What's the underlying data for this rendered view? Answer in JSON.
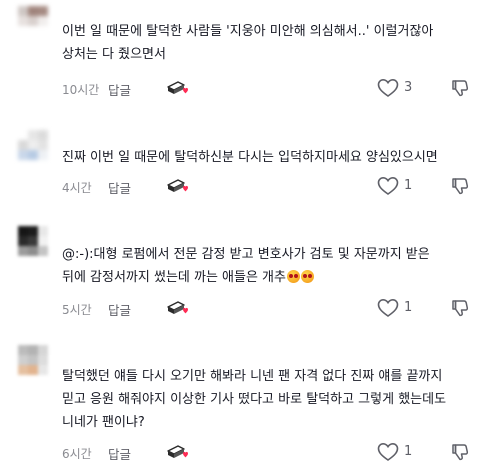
{
  "comments": [
    {
      "text_lines": [
        "이번 일 때문에 탈덕한 사람들 '지웅아 미안해 의심해서..' 이럴거잖아",
        "상처는 다 줬으면서"
      ],
      "time": "10시간",
      "reply_label": "답글",
      "likes": "3",
      "avatar_colors": [
        "#cfc7c4",
        "#a0847c",
        "#a58a82",
        "#e7e1df",
        "#d9d0cd",
        "#f1eeed",
        "#ffffff",
        "#ffffff",
        "#ffffff"
      ]
    },
    {
      "text_lines": [
        "진짜 이번 일 때문에 탈덕하신분 다시는 입덕하지마세요 양심있으시면"
      ],
      "time": "4시간",
      "reply_label": "답글",
      "likes": "1",
      "avatar_colors": [
        "#ffffff",
        "#e6e6e6",
        "#dcdcdc",
        "#d9d9d9",
        "#eeeeee",
        "#e3e3e3",
        "#c9d7ea",
        "#b7cbe4",
        "#eef1f5"
      ]
    },
    {
      "text_lines": [
        "@:-):대형 로펌에서 전문 감정 받고 변호사가 검토 및 자문까지 받은",
        "뒤에 감정서까지 썼는데 까는 애들은 개추"
      ],
      "emojis": [
        "face-emoji",
        "face-emoji"
      ],
      "time": "5시간",
      "reply_label": "답글",
      "likes": "1",
      "avatar_colors": [
        "#161616",
        "#1d1d1d",
        "#e8e8e8",
        "#2a2a2a",
        "#3a3a3a",
        "#f2f2f2",
        "#9b9b9b",
        "#8d8d8d",
        "#c4c4c4"
      ]
    },
    {
      "text_lines": [
        "탈덕했던 얘들 다시 오기만 해봐라 니넨 팬 자격 없다 진짜 얘를 끝까지",
        "믿고 응원 해줘야지 이상한 기사 떴다고 바로 탈덕하고 그렇게 했는데도",
        "니네가 팬이냐?"
      ],
      "time": "6시간",
      "reply_label": "답글",
      "likes": "1",
      "avatar_colors": [
        "#bcbcbc",
        "#b3b3b3",
        "#d6d6d6",
        "#cfcfcf",
        "#c4c4c4",
        "#dddddd",
        "#e5c0a0",
        "#e2b48f",
        "#e7e7e7"
      ]
    }
  ],
  "icons": {
    "gift": "gift-icon",
    "like": "heart-outline-icon",
    "dislike": "thumbs-down-icon",
    "emoji": "face-emoji"
  },
  "colors": {
    "text": "#161823",
    "muted": "#8a8b91",
    "accent_pink": "#fe2c55"
  }
}
